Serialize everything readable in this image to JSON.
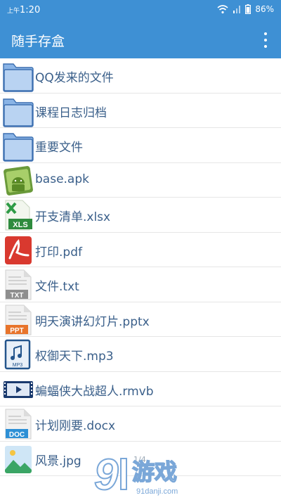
{
  "status": {
    "time_prefix": "上午",
    "time": "1:20",
    "battery": "86%"
  },
  "app": {
    "title": "随手存盒",
    "menu_icon": "more-vert-icon"
  },
  "files": [
    {
      "name": "QQ发来的文件",
      "icon": "folder-icon"
    },
    {
      "name": "课程日志归档",
      "icon": "folder-icon"
    },
    {
      "name": "重要文件",
      "icon": "folder-icon"
    },
    {
      "name": "base.apk",
      "icon": "apk-icon"
    },
    {
      "name": "开支清单.xlsx",
      "icon": "xls-icon"
    },
    {
      "name": "打印.pdf",
      "icon": "pdf-icon"
    },
    {
      "name": "文件.txt",
      "icon": "txt-icon"
    },
    {
      "name": "明天演讲幻灯片.pptx",
      "icon": "ppt-icon"
    },
    {
      "name": "权御天下.mp3",
      "icon": "mp3-icon"
    },
    {
      "name": "蝙蝠侠大战超人.rmvb",
      "icon": "video-icon"
    },
    {
      "name": "计划刚要.docx",
      "icon": "doc-icon"
    },
    {
      "name": "风景.jpg",
      "icon": "image-icon"
    }
  ],
  "labels": {
    "xls": "XLS",
    "txt": "TXT",
    "ppt": "PPT",
    "mp3": "MP3",
    "doc": "DOC",
    "apk_badge": "Android"
  },
  "pager": "1/4",
  "watermark": {
    "brand": "游戏",
    "number": "9",
    "url": "91danji.com"
  },
  "colors": {
    "accent": "#3e90d4",
    "file_name": "#3a5f8a"
  }
}
